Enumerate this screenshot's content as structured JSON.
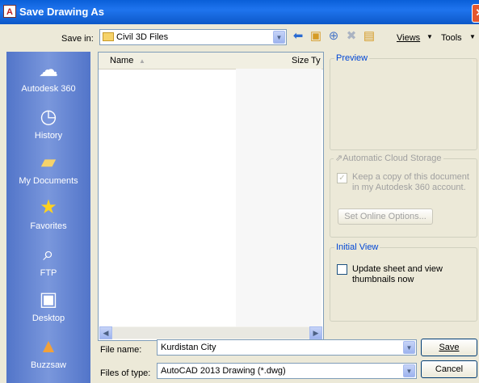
{
  "window": {
    "title": "Save Drawing As",
    "close": "✕",
    "app_icon_letter": "A"
  },
  "toolbar": {
    "save_in_label": "Save in:",
    "save_in_value": "Civil 3D Files",
    "views_label": "Views",
    "tools_label": "Tools"
  },
  "places": [
    {
      "label": "Autodesk 360",
      "icon": "cloud-icon"
    },
    {
      "label": "History",
      "icon": "history-icon"
    },
    {
      "label": "My Documents",
      "icon": "my-documents-icon"
    },
    {
      "label": "Favorites",
      "icon": "favorites-icon"
    },
    {
      "label": "FTP",
      "icon": "ftp-icon"
    },
    {
      "label": "Desktop",
      "icon": "desktop-icon"
    },
    {
      "label": "Buzzsaw",
      "icon": "buzzsaw-icon"
    }
  ],
  "filelist": {
    "col_name": "Name",
    "col_size": "Size",
    "col_type": "Ty"
  },
  "preview": {
    "label": "Preview"
  },
  "cloud": {
    "label": "Automatic Cloud Storage",
    "keep_copy_line1": "Keep a copy of this document",
    "keep_copy_line2": "in my Autodesk 360 account.",
    "set_online_options": "Set Online Options..."
  },
  "initial_view": {
    "label": "Initial View",
    "update_line1": "Update sheet and view",
    "update_line2": "thumbnails now"
  },
  "file": {
    "name_label": "File name:",
    "name_value": "Kurdistan City",
    "type_label": "Files of type:",
    "type_value": "AutoCAD 2013 Drawing (*.dwg)"
  },
  "buttons": {
    "save": "Save",
    "cancel": "Cancel"
  }
}
